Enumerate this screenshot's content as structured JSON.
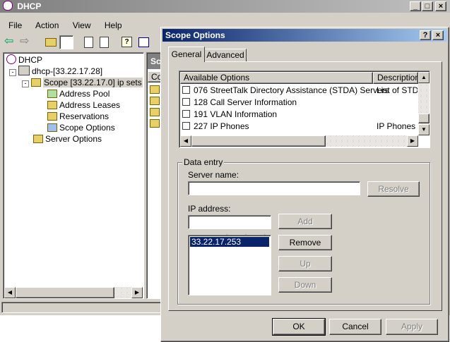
{
  "main_window": {
    "title": "DHCP",
    "menu": [
      {
        "label": "File"
      },
      {
        "label": "Action"
      },
      {
        "label": "View"
      },
      {
        "label": "Help"
      }
    ],
    "tree": {
      "root": "DHCP",
      "server": "dhcp-[33.22.17.28]",
      "scope": "Scope [33.22.17.0] ip sets",
      "scope_children": [
        "Address Pool",
        "Address Leases",
        "Reservations",
        "Scope Options"
      ],
      "server_options": "Server Options"
    },
    "right_pane": {
      "header_fragment": "Sc",
      "column_fragment": "Co"
    }
  },
  "dialog": {
    "title": "Scope Options",
    "tabs": [
      {
        "label": "General",
        "selected": true
      },
      {
        "label": "Advanced",
        "selected": false
      }
    ],
    "options_list": {
      "columns": [
        "Available Options",
        "Description"
      ],
      "rows": [
        {
          "name": "076 StreetTalk Directory Assistance (STDA) Servers",
          "description": "List of STDA"
        },
        {
          "name": "128 Call Server Information",
          "description": ""
        },
        {
          "name": "191 VLAN Information",
          "description": ""
        },
        {
          "name": "227 IP Phones",
          "description": "IP Phones"
        }
      ]
    },
    "data_entry": {
      "group_label": "Data entry",
      "server_name_label": "Server name:",
      "server_name_value": "",
      "resolve_label": "Resolve",
      "ip_label": "IP address:",
      "ip_value": ".       .       .",
      "ip_list": [
        "33.22.17.253"
      ],
      "add_label": "Add",
      "remove_label": "Remove",
      "up_label": "Up",
      "down_label": "Down"
    },
    "buttons": {
      "ok": "OK",
      "cancel": "Cancel",
      "apply": "Apply"
    }
  },
  "colors": {
    "face": "#d4d0c8",
    "active_title": "#0a246a",
    "selection": "#0a246a"
  }
}
